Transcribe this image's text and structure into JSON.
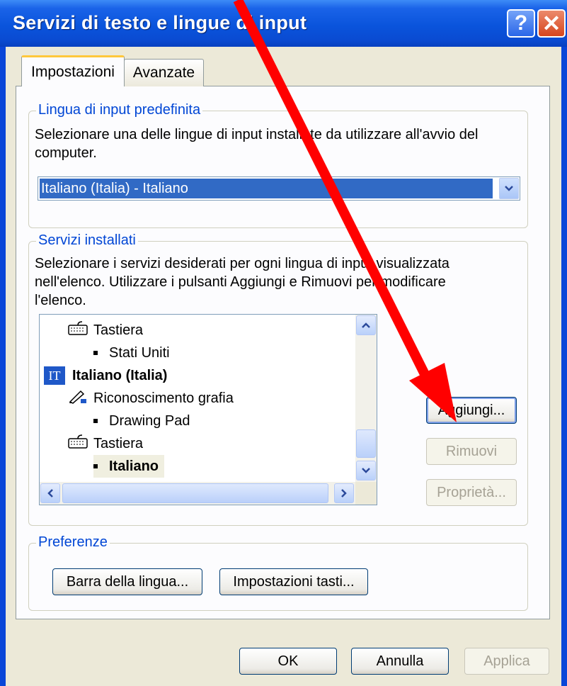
{
  "window": {
    "title": "Servizi di testo e lingue di input",
    "help_glyph": "?",
    "close_glyph": "✕"
  },
  "tabs": [
    {
      "label": "Impostazioni",
      "active": true
    },
    {
      "label": "Avanzate",
      "active": false
    }
  ],
  "default_language": {
    "title": "Lingua di input predefinita",
    "description_line1": "Selezionare una delle lingue di input installate da utilizzare all'avvio del",
    "description_line2": "computer.",
    "selected": "Italiano (Italia) - Italiano"
  },
  "installed_services": {
    "title": "Servizi installati",
    "description_line1": "Selezionare i servizi desiderati per ogni lingua di input visualizzata",
    "description_line2": "nell'elenco. Utilizzare i pulsanti Aggiungi e Rimuovi per modificare",
    "description_line3": "l'elenco.",
    "tree": [
      {
        "label": "Tastiera",
        "icon": "keyboard-icon"
      },
      {
        "label": "Stati Uniti"
      },
      {
        "label": "Italiano (Italia)",
        "badge": "IT"
      },
      {
        "label": "Riconoscimento grafia",
        "icon": "pen-icon"
      },
      {
        "label": "Drawing Pad"
      },
      {
        "label": "Tastiera",
        "icon": "keyboard-icon"
      },
      {
        "label": "Italiano",
        "selected": true
      }
    ],
    "buttons": {
      "add": "Aggiungi...",
      "remove": "Rimuovi",
      "properties": "Proprietà..."
    }
  },
  "preferences": {
    "title": "Preferenze",
    "language_bar": "Barra della lingua...",
    "key_settings": "Impostazioni tasti..."
  },
  "footer": {
    "ok": "OK",
    "cancel": "Annulla",
    "apply": "Applica"
  },
  "colors": {
    "annotation_arrow": "#ff0000",
    "title_bar": "#0a54dc",
    "selection": "#316ac5",
    "group_title": "#0046d5"
  }
}
